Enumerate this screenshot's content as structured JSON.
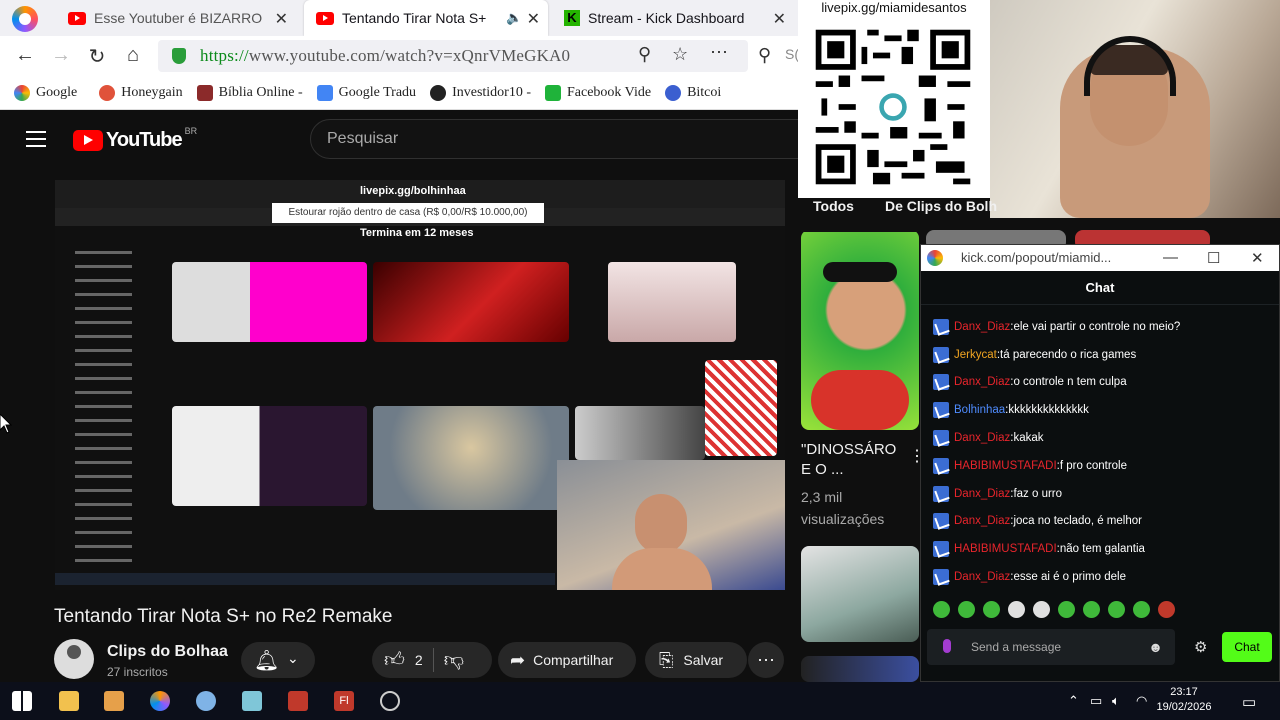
{
  "tabs": [
    {
      "title": "Esse Youtuber é BIZARRO",
      "active": false
    },
    {
      "title": "Tentando Tirar Nota S+",
      "active": true
    },
    {
      "title": "Stream - Kick Dashboard",
      "active": false
    }
  ],
  "address": {
    "prefix": "https://",
    "rest": "www.youtube.com/watch?v=xQnrVMeGKA0",
    "search_partial": "S("
  },
  "bookmarks": [
    "Google",
    "Honeygain",
    "Bíblia Online -",
    "Google Tradu",
    "Investidor10 -",
    "Facebook Vide",
    "Bitcoi"
  ],
  "youtube": {
    "brand": "YouTube",
    "region": "BR",
    "search_placeholder": "Pesquisar"
  },
  "video": {
    "title": "Tentando Tirar Nota S+ no Re2 Remake",
    "livepix_top": "livepix.gg/bolhinhaa",
    "livepix_box": "Estourar rojão dentro de casa (R$ 0,00/R$ 10.000,00)",
    "livepix_end": "Termina em 12 meses",
    "channel": "Clips do Bolhaa",
    "subs": "27 inscritos",
    "likes": "2",
    "share": "Compartilhar",
    "save": "Salvar"
  },
  "overlay": {
    "qr_label": "livepix.gg/miamidesantos",
    "chips": [
      "Todos",
      "De Clips do Bolh"
    ]
  },
  "sidebar_video": {
    "title_line1": "\"DINOSSÁRO",
    "title_line2": "E O ...",
    "views": "2,3 mil",
    "views_suffix": "visualizações"
  },
  "chat": {
    "window_url": "kick.com/popout/miamid...",
    "header": "Chat",
    "messages": [
      {
        "user": "Danx_Diaz",
        "color": "#e8252c",
        "text": "ele vai partir o controle no meio?"
      },
      {
        "user": "Jerkycat",
        "color": "#f1a522",
        "text": "tá parecendo o rica games"
      },
      {
        "user": "Danx_Diaz",
        "color": "#e8252c",
        "text": "o controle n tem culpa"
      },
      {
        "user": "Bolhinhaa",
        "color": "#4f8cff",
        "text": "kkkkkkkkkkkkkk"
      },
      {
        "user": "Danx_Diaz",
        "color": "#e8252c",
        "text": "kakak"
      },
      {
        "user": "HABIBIMUSTAFADI",
        "color": "#e8252c",
        "text": "f pro controle"
      },
      {
        "user": "Danx_Diaz",
        "color": "#e8252c",
        "text": "faz o urro"
      },
      {
        "user": "Danx_Diaz",
        "color": "#e8252c",
        "text": "joca no teclado, é melhor"
      },
      {
        "user": "HABIBIMUSTAFADI",
        "color": "#e8252c",
        "text": "não tem galantia"
      },
      {
        "user": "Danx_Diaz",
        "color": "#e8252c",
        "text": "esse ai é o primo dele"
      }
    ],
    "placeholder": "Send a message",
    "send_label": "Chat",
    "accent": "#53fc18"
  },
  "taskbar": {
    "time": "23:17",
    "date": "19/02/2026"
  }
}
